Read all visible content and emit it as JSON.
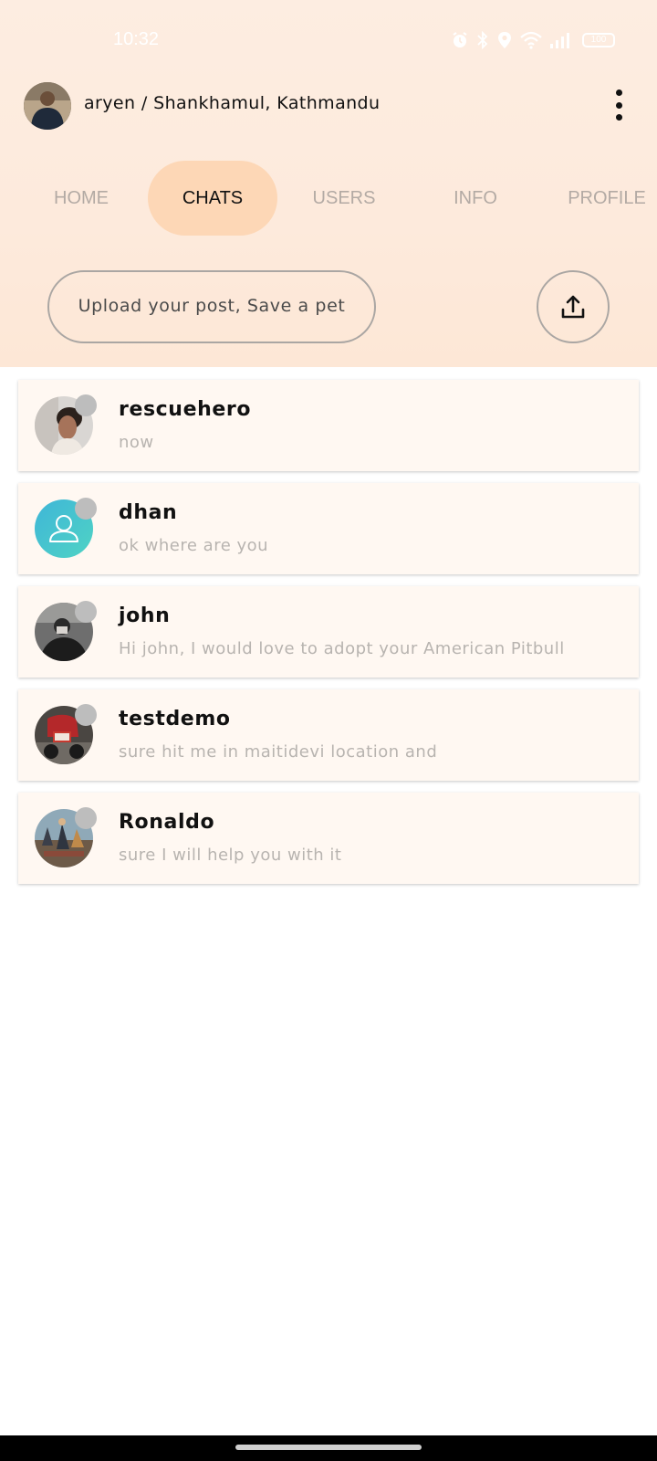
{
  "status_bar": {
    "time": "10:32",
    "battery": "100",
    "icons": [
      "alarm-icon",
      "bluetooth-icon",
      "location-icon",
      "wifi-icon",
      "signal-icon",
      "battery-icon"
    ]
  },
  "header": {
    "title": "aryen / Shankhamul, Kathmandu",
    "menu_icon": "more-vert-icon"
  },
  "tabs": [
    {
      "label": "HOME",
      "active": false
    },
    {
      "label": "CHATS",
      "active": true
    },
    {
      "label": "USERS",
      "active": false
    },
    {
      "label": "INFO",
      "active": false
    },
    {
      "label": "PROFILE",
      "active": false
    }
  ],
  "upload": {
    "text": "Upload your post, Save a pet",
    "button_icon": "upload-icon"
  },
  "chats": [
    {
      "name": "rescuehero",
      "message": "now"
    },
    {
      "name": "dhan",
      "message": "ok where are you"
    },
    {
      "name": "john",
      "message": "Hi john, I would love to adopt your American Pitbull"
    },
    {
      "name": "testdemo",
      "message": "sure hit me in maitidevi location and"
    },
    {
      "name": "Ronaldo",
      "message": "sure I will help you with it"
    }
  ],
  "colors": {
    "header_bg": "#fdeadc",
    "active_tab_bg": "#fdd7b6",
    "inactive_tab_text": "#b3aaa4",
    "chat_item_bg": "#fff8f2",
    "status_dot": "#bdbdbd",
    "default_avatar": "#3fc6c6"
  }
}
